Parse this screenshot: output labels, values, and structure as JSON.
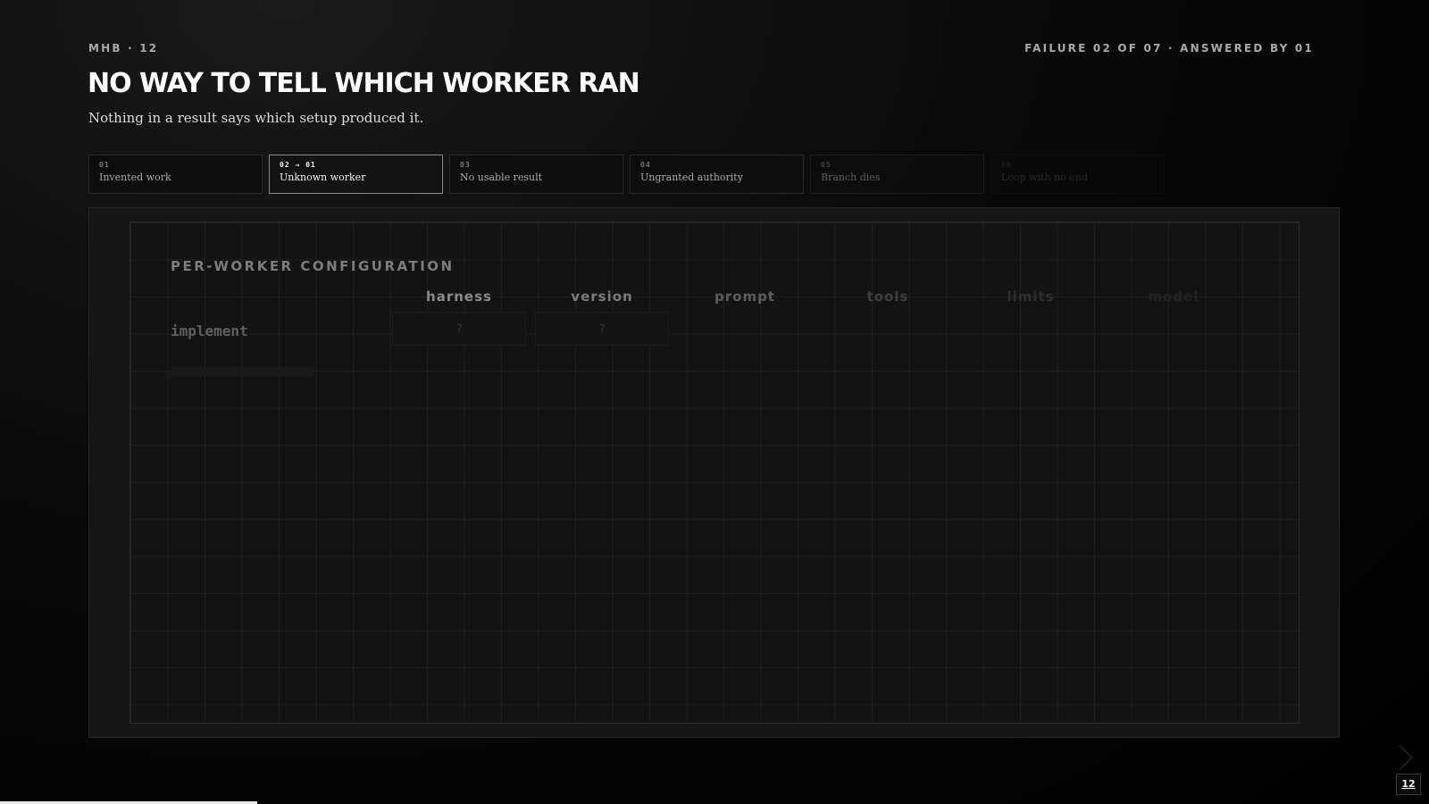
{
  "header": {
    "kicker_left": "MHB · 12",
    "kicker_right": "FAILURE 02 OF 07 · ANSWERED BY 01",
    "title": "NO WAY TO TELL WHICH WORKER RAN",
    "subtitle": "Nothing in a result says which setup produced it."
  },
  "tabs": [
    {
      "num": "01",
      "label": "Invented work"
    },
    {
      "num": "02 → 01",
      "label": "Unknown worker",
      "active": true
    },
    {
      "num": "03",
      "label": "No usable result"
    },
    {
      "num": "04",
      "label": "Ungranted authority"
    },
    {
      "num": "05",
      "label": "Branch dies"
    },
    {
      "num": "06",
      "label": "Loop with no end"
    }
  ],
  "panel": {
    "title": "PER-WORKER CONFIGURATION",
    "columns": [
      "harness",
      "version",
      "prompt",
      "tools",
      "limits",
      "model"
    ],
    "column_colors": [
      "#8a8a8a",
      "#7a7a7a",
      "#5c5c5c",
      "#3f3f3f",
      "#2e2e2e",
      "#232323"
    ],
    "row_label": "implement",
    "cells": [
      "?",
      "?"
    ]
  },
  "footer": {
    "page_number": "12",
    "progress_fraction": 0.18
  }
}
